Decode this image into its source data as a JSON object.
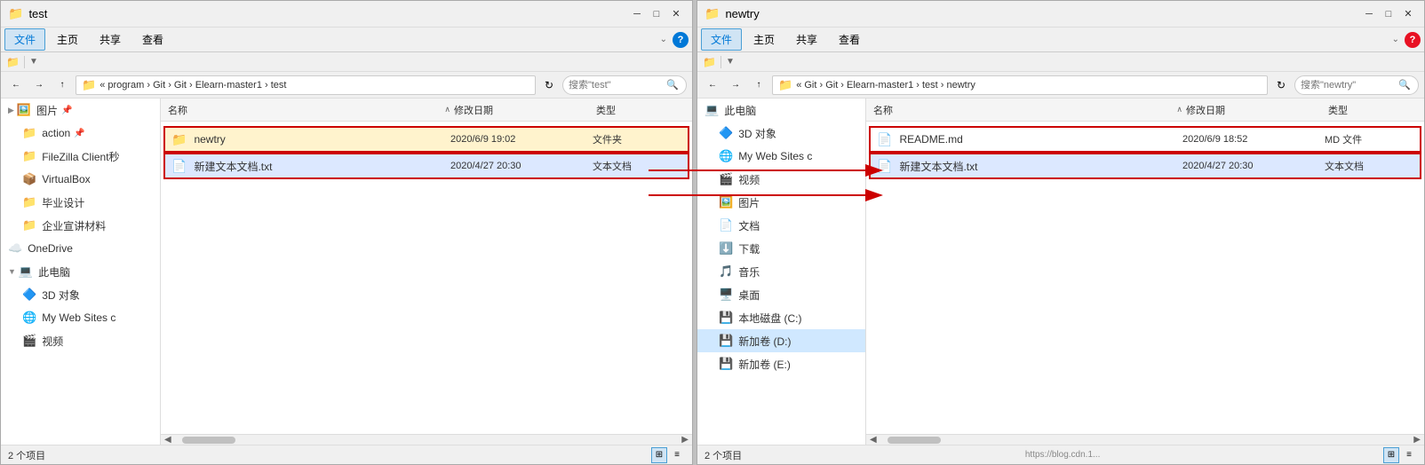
{
  "left_window": {
    "title": "test",
    "title_icon": "📁",
    "tabs": [
      "文件",
      "主页",
      "共享",
      "查看"
    ],
    "active_tab": "文件",
    "quick_toolbar": {
      "icon": "📁"
    },
    "address": {
      "path": "« program › Git › Git › Elearn-master1 › test",
      "refresh": "↻",
      "search_placeholder": "搜索\"test\"",
      "nav_back": "←",
      "nav_forward": "→",
      "nav_up": "↑"
    },
    "columns": {
      "name": "名称",
      "modified": "修改日期",
      "type": "类型",
      "sort_indicator": "∧"
    },
    "files": [
      {
        "name": "newtry",
        "date": "2020/6/9 19:02",
        "type": "文件夹",
        "icon": "📁",
        "highlighted": true
      },
      {
        "name": "新建文本文档.txt",
        "date": "2020/4/27 20:30",
        "type": "文本文档",
        "icon": "📄",
        "highlighted": true
      }
    ],
    "sidebar": {
      "items": [
        {
          "icon": "🖼️",
          "label": "图片",
          "pinned": true,
          "level": 1
        },
        {
          "icon": "📁",
          "label": "action",
          "pinned": true,
          "level": 2,
          "bold": false
        },
        {
          "icon": "📁",
          "label": "FileZilla Client秒",
          "level": 2
        },
        {
          "icon": "📦",
          "label": "VirtualBox",
          "level": 2
        },
        {
          "icon": "📁",
          "label": "毕业设计",
          "level": 2
        },
        {
          "icon": "📁",
          "label": "企业宣讲材料",
          "level": 2
        },
        {
          "icon": "☁️",
          "label": "OneDrive",
          "level": 1
        },
        {
          "icon": "💻",
          "label": "此电脑",
          "level": 1,
          "expanded": true
        },
        {
          "icon": "🔷",
          "label": "3D 对象",
          "level": 2
        },
        {
          "icon": "🌐",
          "label": "My Web Sites c",
          "level": 2
        },
        {
          "icon": "🎬",
          "label": "视频",
          "level": 2
        }
      ]
    },
    "status": "2 个项目"
  },
  "right_window": {
    "title": "newtry",
    "title_icon": "📁",
    "tabs": [
      "文件",
      "主页",
      "共享",
      "查看"
    ],
    "active_tab": "文件",
    "address": {
      "path": "« Git › Git › Elearn-master1 › test › newtry",
      "refresh": "↻",
      "search_placeholder": "搜索\"newtry\"",
      "nav_back": "←",
      "nav_forward": "→",
      "nav_up": "↑"
    },
    "columns": {
      "name": "名称",
      "modified": "修改日期",
      "type": "类型",
      "sort_indicator": "∧"
    },
    "files": [
      {
        "name": "README.md",
        "date": "2020/6/9 18:52",
        "type": "MD 文件",
        "icon": "📄",
        "highlighted": true
      },
      {
        "name": "新建文本文档.txt",
        "date": "2020/4/27 20:30",
        "type": "文本文档",
        "icon": "📄",
        "highlighted": true
      }
    ],
    "sidebar": {
      "items": [
        {
          "icon": "💻",
          "label": "此电脑",
          "level": 1
        },
        {
          "icon": "🔷",
          "label": "3D 对象",
          "level": 2
        },
        {
          "icon": "🌐",
          "label": "My Web Sites c",
          "level": 2
        },
        {
          "icon": "🎬",
          "label": "视频",
          "level": 2
        },
        {
          "icon": "🖼️",
          "label": "图片",
          "level": 2
        },
        {
          "icon": "📄",
          "label": "文档",
          "level": 2
        },
        {
          "icon": "⬇️",
          "label": "下载",
          "level": 2
        },
        {
          "icon": "🎵",
          "label": "音乐",
          "level": 2
        },
        {
          "icon": "🖥️",
          "label": "桌面",
          "level": 2
        },
        {
          "icon": "💾",
          "label": "本地磁盘 (C:)",
          "level": 2
        },
        {
          "icon": "💾",
          "label": "新加卷 (D:)",
          "level": 2
        },
        {
          "icon": "💾",
          "label": "新加卷 (E:)",
          "level": 2
        }
      ]
    },
    "status": "2 个项目",
    "url_hint": "https://blog.cdn.1..."
  },
  "icons": {
    "minimize": "─",
    "maximize": "□",
    "close": "✕",
    "search": "🔍",
    "grid_view": "⊞",
    "list_view": "≡",
    "chevron_down": "⌄",
    "help": "?"
  }
}
